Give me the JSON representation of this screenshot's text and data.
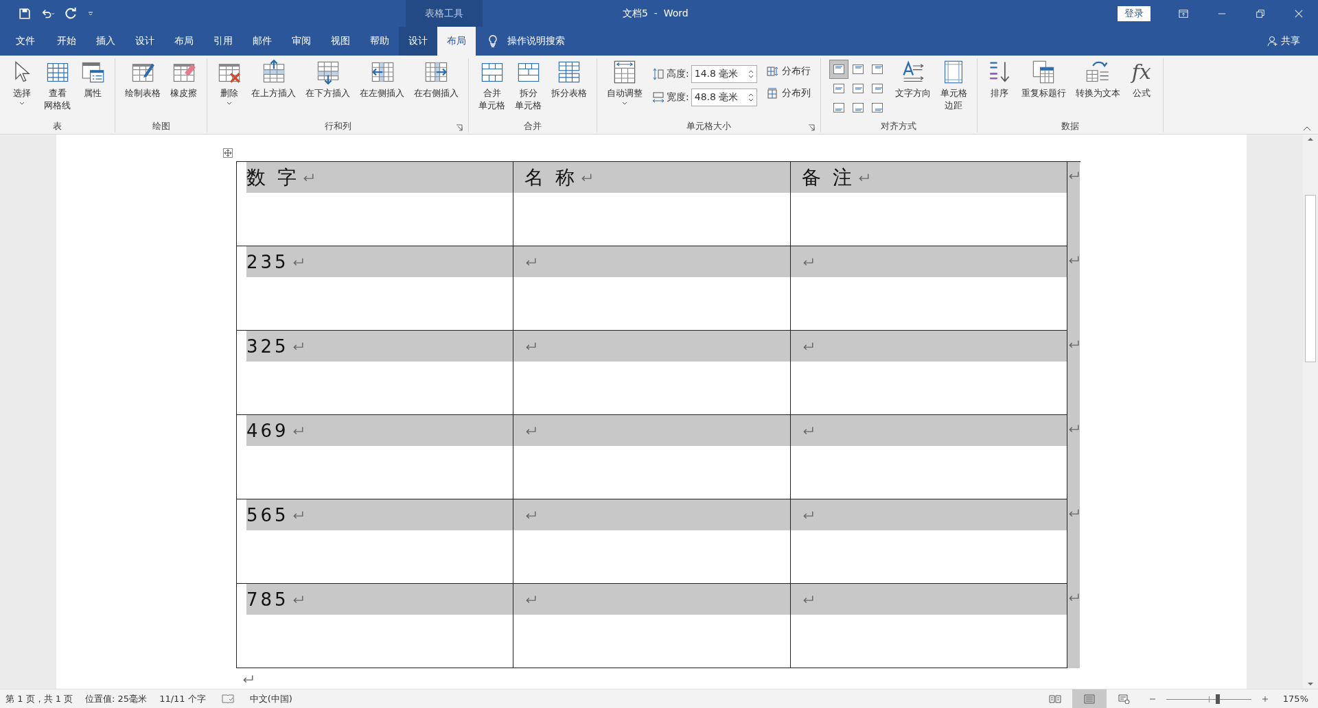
{
  "title_bar": {
    "contextual_label": "表格工具",
    "title": "文档5  -  Word",
    "login_button": "登录"
  },
  "menu_tabs": [
    {
      "label": "文件",
      "kind": "normal",
      "selected": false
    },
    {
      "label": "开始",
      "kind": "normal",
      "selected": false
    },
    {
      "label": "插入",
      "kind": "normal",
      "selected": false
    },
    {
      "label": "设计",
      "kind": "normal",
      "selected": false
    },
    {
      "label": "布局",
      "kind": "normal",
      "selected": false
    },
    {
      "label": "引用",
      "kind": "normal",
      "selected": false
    },
    {
      "label": "邮件",
      "kind": "normal",
      "selected": false
    },
    {
      "label": "审阅",
      "kind": "normal",
      "selected": false
    },
    {
      "label": "视图",
      "kind": "normal",
      "selected": false
    },
    {
      "label": "帮助",
      "kind": "normal",
      "selected": false
    },
    {
      "label": "设计",
      "kind": "contextual",
      "selected": false
    },
    {
      "label": "布局",
      "kind": "contextual",
      "selected": true
    }
  ],
  "tell_me": "操作说明搜索",
  "share_button": "共享",
  "ribbon_groups": [
    {
      "label": "表",
      "dialog_launcher": false,
      "items": [
        {
          "kind": "large",
          "label": "选择",
          "dropdown": true
        },
        {
          "kind": "large",
          "lines": [
            "查看",
            "网格线"
          ],
          "dropdown": false
        },
        {
          "kind": "large",
          "label": "属性",
          "dropdown": false
        }
      ]
    },
    {
      "label": "绘图",
      "dialog_launcher": false,
      "items": [
        {
          "kind": "large",
          "label": "绘制表格",
          "dropdown": false
        },
        {
          "kind": "large",
          "label": "橡皮擦",
          "dropdown": false
        }
      ]
    },
    {
      "label": "行和列",
      "dialog_launcher": true,
      "items": [
        {
          "kind": "large",
          "label": "删除",
          "dropdown": true
        },
        {
          "kind": "large",
          "label": "在上方插入",
          "dropdown": false
        },
        {
          "kind": "large",
          "label": "在下方插入",
          "dropdown": false
        },
        {
          "kind": "large",
          "label": "在左侧插入",
          "dropdown": false
        },
        {
          "kind": "large",
          "label": "在右侧插入",
          "dropdown": false
        }
      ]
    },
    {
      "label": "合并",
      "dialog_launcher": false,
      "items": [
        {
          "kind": "large",
          "lines": [
            "合并",
            "单元格"
          ],
          "dropdown": false
        },
        {
          "kind": "large",
          "lines": [
            "拆分",
            "单元格"
          ],
          "dropdown": false
        },
        {
          "kind": "large",
          "label": "拆分表格",
          "dropdown": false
        }
      ]
    },
    {
      "label": "单元格大小",
      "dialog_launcher": true,
      "items": [
        {
          "kind": "large",
          "label": "自动调整",
          "dropdown": true
        },
        {
          "kind": "size_fields",
          "fields": [
            {
              "label": "高度:",
              "value": "14.8 毫米"
            },
            {
              "label": "宽度:",
              "value": "48.8 毫米"
            }
          ]
        },
        {
          "kind": "small_stack",
          "buttons": [
            "分布行",
            "分布列"
          ]
        }
      ]
    },
    {
      "label": "对齐方式",
      "dialog_launcher": false,
      "items": [
        {
          "kind": "align_grid",
          "cells": [
            {
              "selected": true
            },
            {
              "selected": false
            },
            {
              "selected": false
            },
            {
              "selected": false
            },
            {
              "selected": false
            },
            {
              "selected": false
            },
            {
              "selected": false
            },
            {
              "selected": false
            },
            {
              "selected": false
            }
          ]
        },
        {
          "kind": "large",
          "label": "文字方向",
          "dropdown": false
        },
        {
          "kind": "large",
          "lines": [
            "单元格",
            "边距"
          ],
          "dropdown": false
        }
      ]
    },
    {
      "label": "数据",
      "dialog_launcher": false,
      "items": [
        {
          "kind": "large",
          "label": "排序",
          "dropdown": false
        },
        {
          "kind": "large",
          "label": "重复标题行",
          "dropdown": false
        },
        {
          "kind": "large",
          "label": "转换为文本",
          "dropdown": false
        },
        {
          "kind": "large",
          "label": "公式",
          "glyph": "fx",
          "dropdown": false
        }
      ]
    }
  ],
  "table": {
    "columns": [
      "数 字",
      "名 称",
      "备 注"
    ],
    "rows": [
      {
        "number": "235"
      },
      {
        "number": "325"
      },
      {
        "number": "469"
      },
      {
        "number": "565"
      },
      {
        "number": "785"
      }
    ]
  },
  "status_bar": {
    "page": "第 1 页，共 1 页",
    "position": "位置值: 25毫米",
    "word_count": "11/11 个字",
    "language": "中文(中国)",
    "views": [
      {
        "selected": false
      },
      {
        "selected": true
      },
      {
        "selected": false
      }
    ],
    "zoom_slider": {
      "level": 0.58
    },
    "zoom": "175%"
  }
}
